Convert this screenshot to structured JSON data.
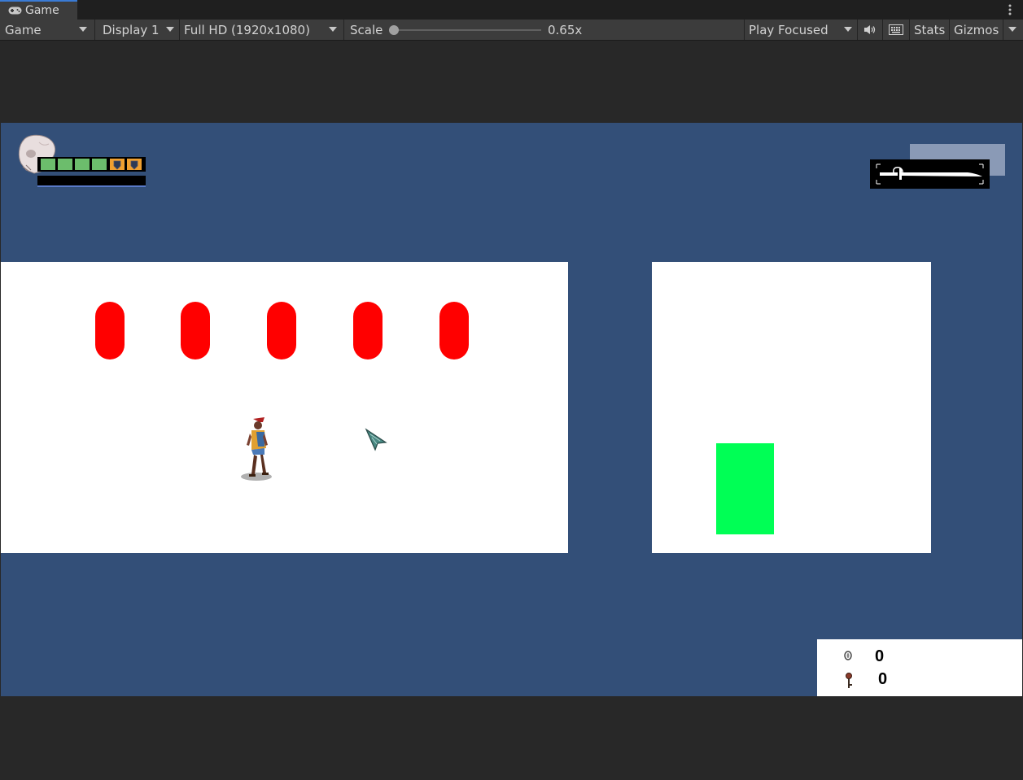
{
  "window": {
    "tab_title": "Game"
  },
  "toolbar": {
    "view_mode": "Game",
    "display": "Display 1",
    "resolution": "Full HD (1920x1080)",
    "scale_label": "Scale",
    "scale_value": "0.65x",
    "scale_fraction": 0,
    "play_mode": "Play Focused",
    "stats_label": "Stats",
    "gizmos_label": "Gizmos",
    "icons": [
      "gamepad-icon",
      "dropdown-arrow-icon",
      "audio-mute-icon",
      "keyboard-icon",
      "kebab-menu-icon"
    ]
  },
  "game": {
    "background_color": "#334f78",
    "obstacle_color": "#ff0000",
    "goal_color": "#00ff55",
    "hud": {
      "health_cells": [
        {
          "state": "full"
        },
        {
          "state": "full"
        },
        {
          "state": "full"
        },
        {
          "state": "full"
        },
        {
          "state": "shield"
        },
        {
          "state": "shield"
        }
      ],
      "weapon_icon": "sword-icon",
      "portrait_icon": "skull-icon"
    },
    "counters": {
      "coins": "0",
      "keys": "0"
    }
  }
}
